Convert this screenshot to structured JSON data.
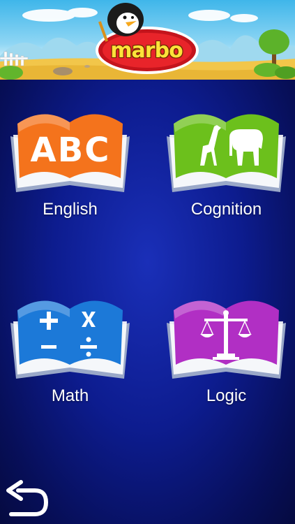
{
  "header": {
    "logo_text": "marbo"
  },
  "categories": [
    {
      "label": "English",
      "cover_text": "ABC",
      "color": "#f4731c",
      "icon": "abc-icon"
    },
    {
      "label": "Cognition",
      "color": "#6cc01c",
      "icon": "giraffe-elephant-icon"
    },
    {
      "label": "Math",
      "color": "#1c79d8",
      "icon": "math-operators-icon"
    },
    {
      "label": "Logic",
      "color": "#b12fc4",
      "icon": "scale-icon"
    }
  ],
  "back_button": {
    "icon": "back-arrow-icon"
  }
}
